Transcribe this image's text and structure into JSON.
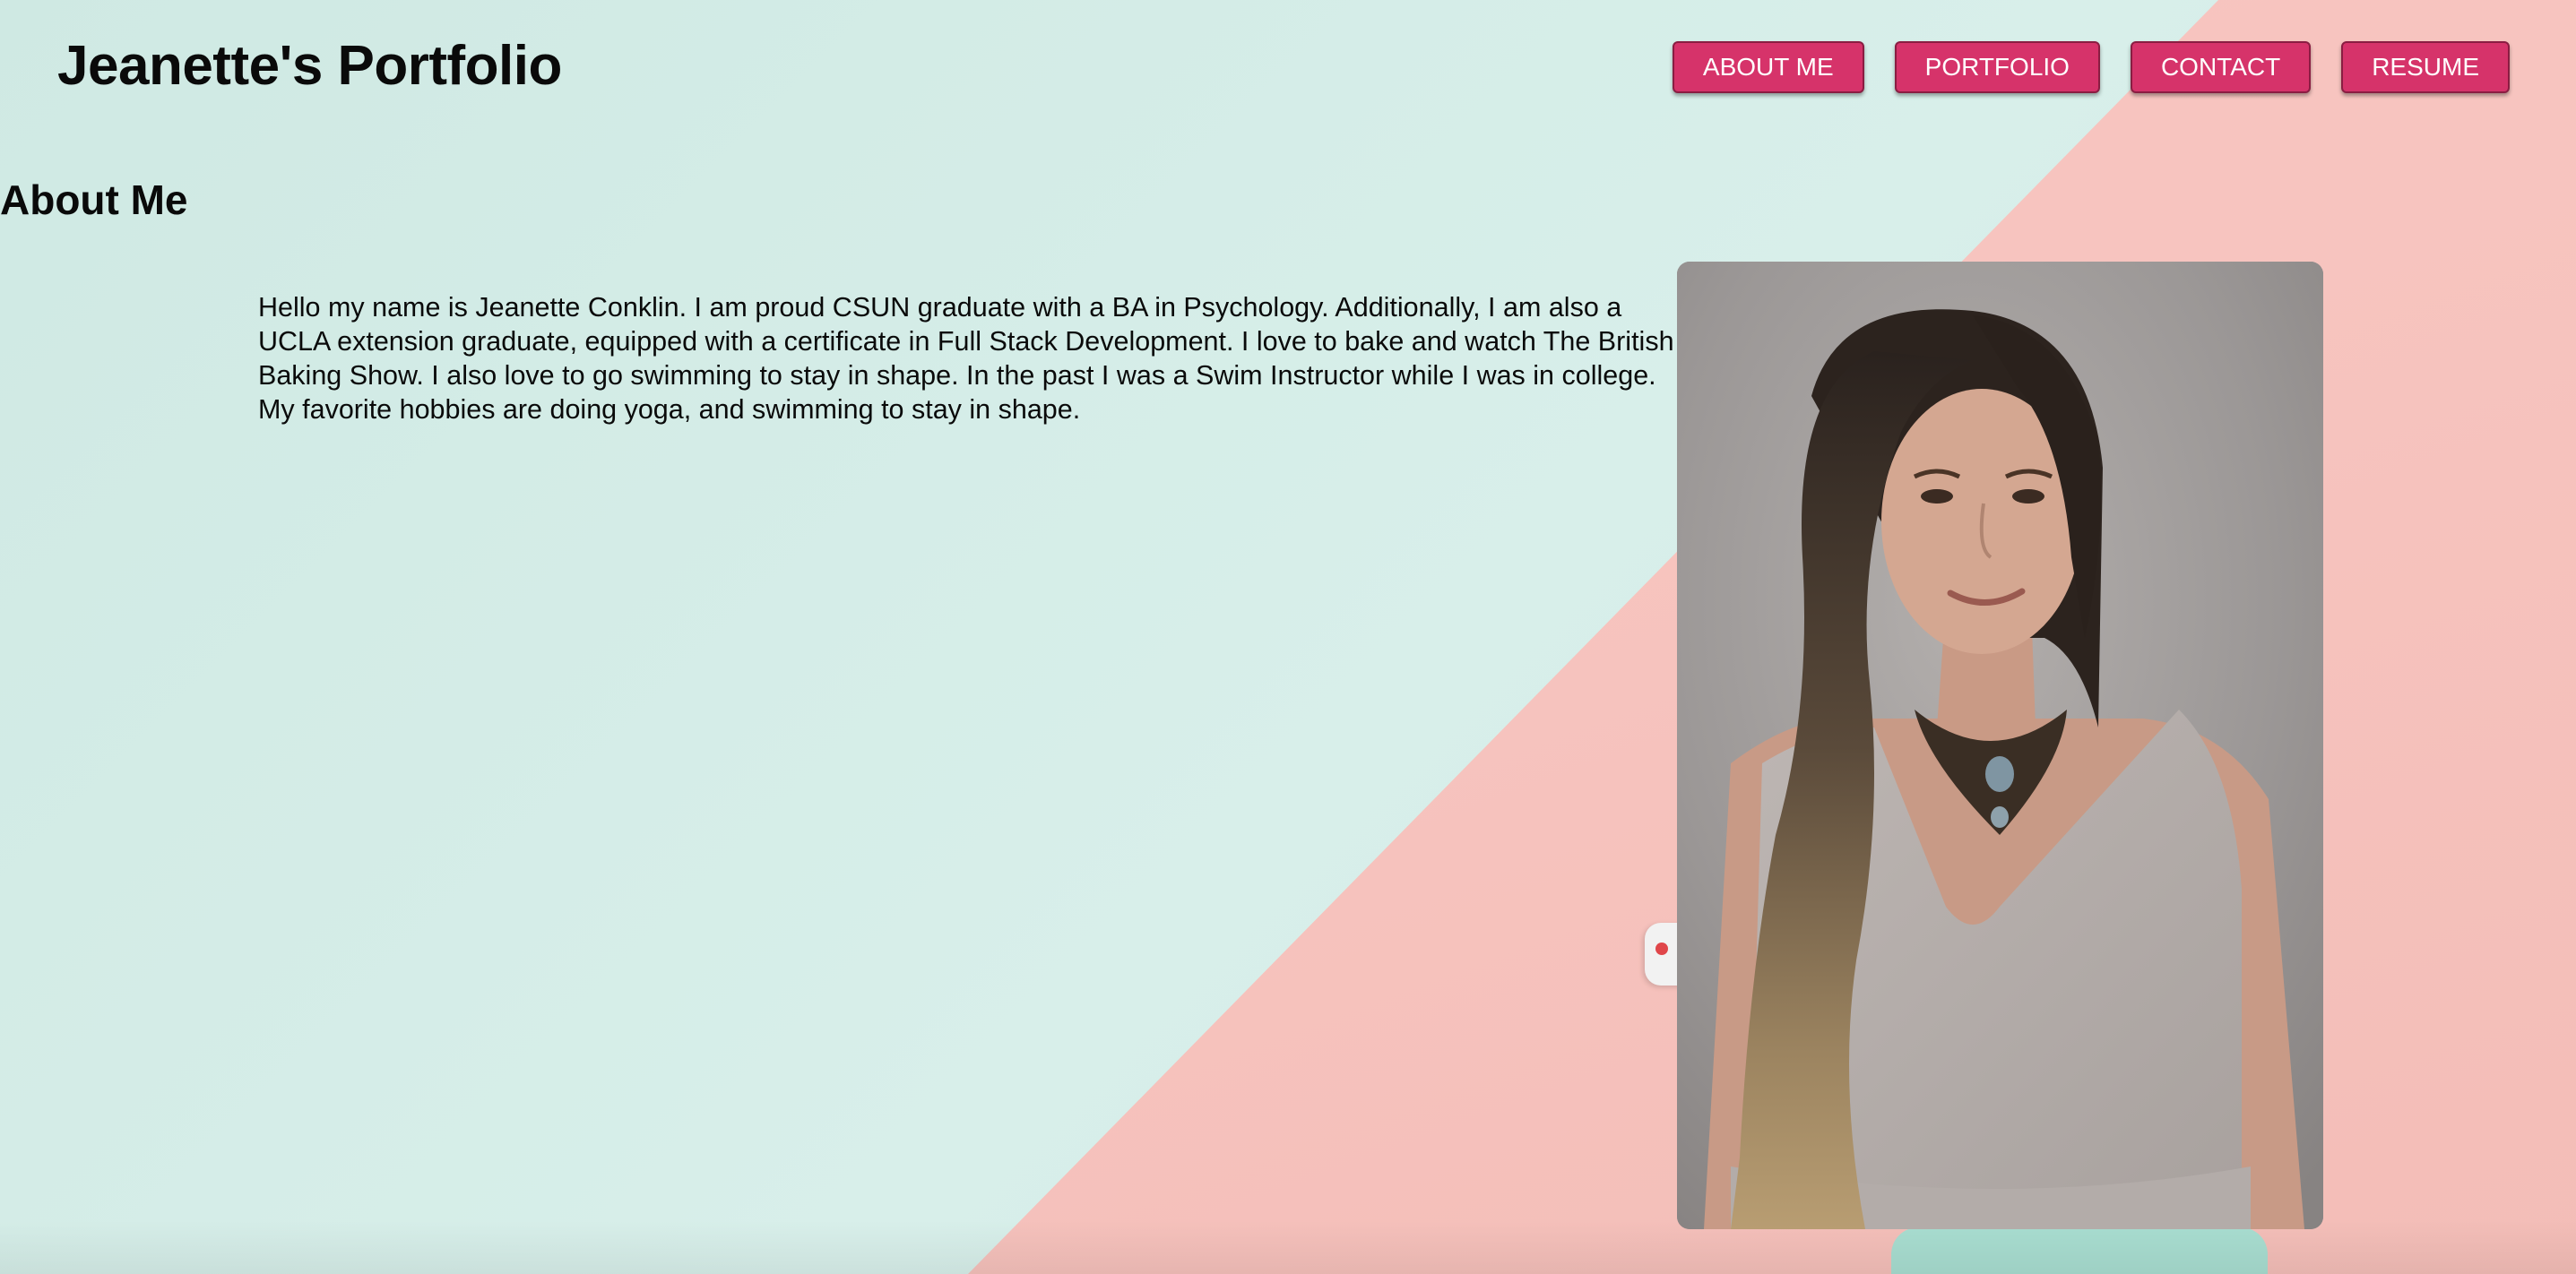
{
  "site": {
    "title": "Jeanette's Portfolio"
  },
  "nav": {
    "items": [
      {
        "label": "ABOUT ME"
      },
      {
        "label": "PORTFOLIO"
      },
      {
        "label": "CONTACT"
      },
      {
        "label": "RESUME"
      }
    ]
  },
  "about": {
    "heading": "About Me",
    "bio": "Hello my name is Jeanette Conklin. I am proud CSUN graduate with a BA in Psychology. Additionally, I am also a UCLA extension graduate, equipped with a certificate in Full Stack Development. I love to bake and watch The British Baking Show. I also love to go swimming to stay in shape. In the past I was a Swim Instructor while I was in college. My favorite hobbies are doing yoga, and swimming to stay in shape."
  },
  "colors": {
    "nav_button": "#d6336a",
    "background_mint": "#d3ece6",
    "background_pink": "#f6c6c0"
  }
}
